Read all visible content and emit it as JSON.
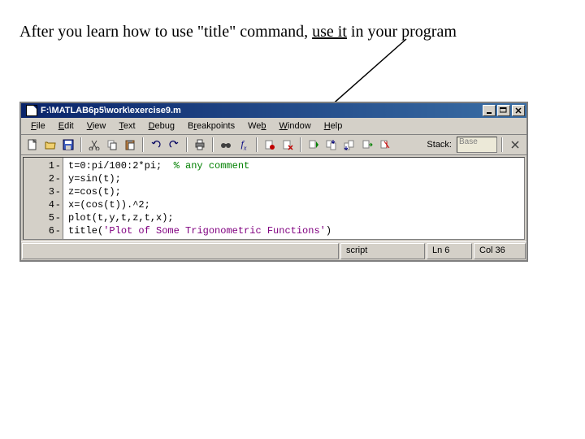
{
  "caption": {
    "before": "After you learn how to use \"title\" command, ",
    "underlined": "use it",
    "after": " in your program"
  },
  "window": {
    "title": "F:\\MATLAB6p5\\work\\exercise9.m",
    "controls": {
      "min": "_",
      "max": "❐",
      "close": "✕"
    }
  },
  "menu": {
    "file": "File",
    "edit": "Edit",
    "view": "View",
    "text": "Text",
    "debug": "Debug",
    "breakpoints": "Breakpoints",
    "web": "Web",
    "window": "Window",
    "help": "Help"
  },
  "toolbar": {
    "names": [
      "new",
      "open",
      "save",
      "cut",
      "copy",
      "paste",
      "undo",
      "redo",
      "print",
      "find",
      "fx",
      "set-bp",
      "clear-bp",
      "step",
      "step-in",
      "step-out",
      "continue",
      "exit-debug"
    ],
    "stack_label": "Stack:",
    "stack_value": "Base"
  },
  "code": {
    "lines": [
      {
        "n": 1,
        "text": "t=0:pi/100:2*pi;  ",
        "comment": "% any comment"
      },
      {
        "n": 2,
        "text": "y=sin(t);"
      },
      {
        "n": 3,
        "text": "z=cos(t);"
      },
      {
        "n": 4,
        "text": "x=(cos(t)).^2;"
      },
      {
        "n": 5,
        "text": "plot(t,y,t,z,t,x);"
      },
      {
        "n": 6,
        "text": "title(",
        "string": "'Plot of Some Trigonometric Functions'",
        "tail": ")"
      }
    ]
  },
  "status": {
    "type": "script",
    "ln": "Ln 6",
    "col": "Col 36"
  }
}
